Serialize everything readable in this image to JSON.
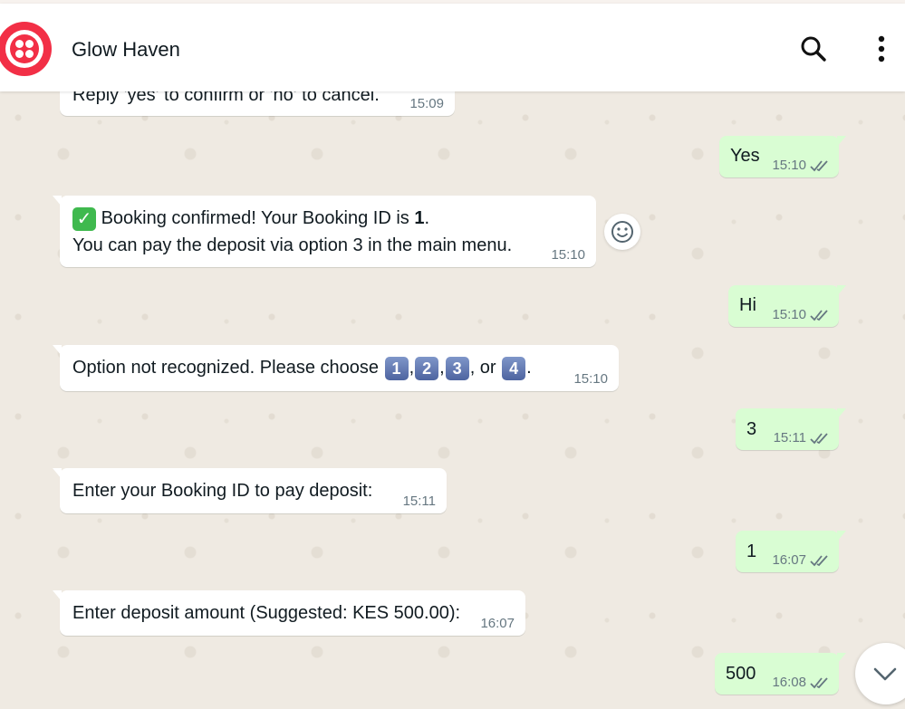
{
  "header": {
    "title": "Glow Haven"
  },
  "messages": {
    "m0": {
      "text": "Reply 'yes' to confirm or 'no' to cancel.",
      "time": "15:09"
    },
    "m1": {
      "text": "Yes",
      "time": "15:10"
    },
    "m2": {
      "line1_pre": "Booking confirmed! Your Booking ID is ",
      "booking_id": "1",
      "line1_post": ".",
      "line2": "You can pay the deposit via option 3 in the main menu.",
      "time": "15:10"
    },
    "m3": {
      "text": "Hi",
      "time": "15:10"
    },
    "m4": {
      "pre": "Option not recognized. Please choose ",
      "k1": "1",
      "k2": "2",
      "k3": "3",
      "k4": "4",
      "sep": ",",
      "or": ", or",
      "end": ".",
      "time": "15:10"
    },
    "m5": {
      "text": "3",
      "time": "15:11"
    },
    "m6": {
      "text": "Enter your Booking ID to pay deposit:",
      "time": "15:11"
    },
    "m7": {
      "text": "1",
      "time": "16:07"
    },
    "m8": {
      "text": "Enter deposit amount (Suggested: KES 500.00):",
      "time": "16:07"
    },
    "m9": {
      "text": "500",
      "time": "16:08"
    }
  },
  "icons": {
    "avatar": "twilio-logo-icon",
    "search": "search-icon",
    "menu": "more-vertical-icon",
    "ticks": "double-check-icon",
    "react": "emoji-icon",
    "scroll": "chevron-down-icon",
    "confirm": "check-mark-emoji-icon"
  },
  "colors": {
    "brand": "#f22f46",
    "outgoing_bubble": "#d9fdd3",
    "incoming_bubble": "#ffffff",
    "chat_background": "#efeae2"
  }
}
